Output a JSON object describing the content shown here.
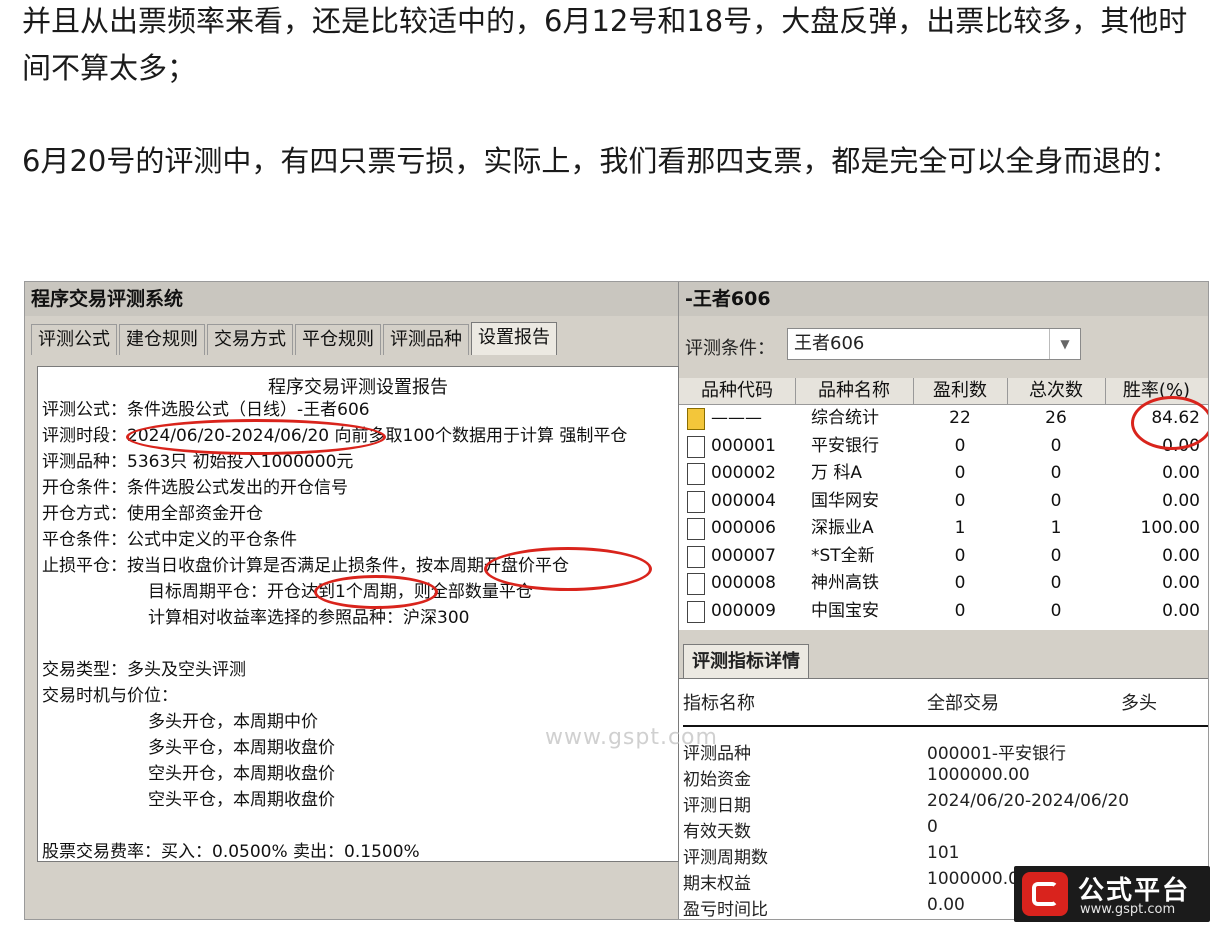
{
  "article": {
    "paragraph1": "并且从出票频率来看，还是比较适中的，6月12号和18号，大盘反弹，出票比较多，其他时间不算太多；",
    "paragraph2": "6月20号的评测中，有四只票亏损，实际上，我们看那四支票，都是完全可以全身而退的："
  },
  "left_panel": {
    "title": "程序交易评测系统",
    "tabs": [
      "评测公式",
      "建仓规则",
      "交易方式",
      "平仓规则",
      "评测品种",
      "设置报告"
    ],
    "active_tab": "设置报告",
    "report_title": "程序交易评测设置报告",
    "lines": {
      "formula": "评测公式：条件选股公式（日线）-王者606",
      "period": "评测时段：2024/06/20-2024/06/20 向前多取100个数据用于计算 强制平仓",
      "varieties": "评测品种：5363只 初始投入1000000元",
      "open_cond": "开仓条件：条件选股公式发出的开仓信号",
      "open_mode": "开仓方式：使用全部资金开仓",
      "close_cond": "平仓条件：公式中定义的平仓条件",
      "stop_loss": "止损平仓：按当日收盘价计算是否满足止损条件，按本周期开盘价平仓",
      "target_close": "目标周期平仓：开仓达到1个周期，则全部数量平仓",
      "benchmark": "计算相对收益率选择的参照品种：沪深300",
      "trade_type": "交易类型：多头及空头评测",
      "timing_title": "交易时机与价位：",
      "timing1": "多头开仓，本周期中价",
      "timing2": "多头平仓，本周期收盘价",
      "timing3": "空头开仓，本周期收盘价",
      "timing4": "空头平仓，本周期收盘价",
      "fees": "股票交易费率：买入：0.0500%  卖出：0.1500%"
    }
  },
  "right_panel": {
    "title": "-王者606",
    "condition_label": "评测条件：",
    "condition_value": "王者606",
    "table": {
      "headers": [
        "品种代码",
        "品种名称",
        "盈利数",
        "总次数",
        "胜率(%)"
      ],
      "rows": [
        {
          "code": "———",
          "name": "综合统计",
          "profit": "22",
          "total": "26",
          "rate": "84.62",
          "icon": "folder"
        },
        {
          "code": "000001",
          "name": "平安银行",
          "profit": "0",
          "total": "0",
          "rate": "0.00",
          "icon": "doc"
        },
        {
          "code": "000002",
          "name": "万 科A",
          "profit": "0",
          "total": "0",
          "rate": "0.00",
          "icon": "doc"
        },
        {
          "code": "000004",
          "name": "国华网安",
          "profit": "0",
          "total": "0",
          "rate": "0.00",
          "icon": "doc"
        },
        {
          "code": "000006",
          "name": "深振业A",
          "profit": "1",
          "total": "1",
          "rate": "100.00",
          "icon": "doc"
        },
        {
          "code": "000007",
          "name": "*ST全新",
          "profit": "0",
          "total": "0",
          "rate": "0.00",
          "icon": "doc"
        },
        {
          "code": "000008",
          "name": "神州高铁",
          "profit": "0",
          "total": "0",
          "rate": "0.00",
          "icon": "doc"
        },
        {
          "code": "000009",
          "name": "中国宝安",
          "profit": "0",
          "total": "0",
          "rate": "0.00",
          "icon": "doc"
        }
      ]
    },
    "detail_tab": "评测指标详情",
    "detail_headers": [
      "指标名称",
      "全部交易",
      "多头"
    ],
    "detail_rows": [
      {
        "label": "评测品种",
        "value": "000001-平安银行"
      },
      {
        "label": "初始资金",
        "value": "1000000.00"
      },
      {
        "label": "评测日期",
        "value": "2024/06/20-2024/06/20"
      },
      {
        "label": "有效天数",
        "value": "0"
      },
      {
        "label": "评测周期数",
        "value": "101"
      },
      {
        "label": "期末权益",
        "value": "1000000.00"
      },
      {
        "label": "盈亏时间比",
        "value": "0.00"
      }
    ]
  },
  "watermark": "www.gspt.com",
  "brand": {
    "name": "公式平台",
    "url": "www.gspt.com"
  },
  "colors": {
    "highlight": "#d9241c",
    "window_bg": "#d4d0c8"
  }
}
